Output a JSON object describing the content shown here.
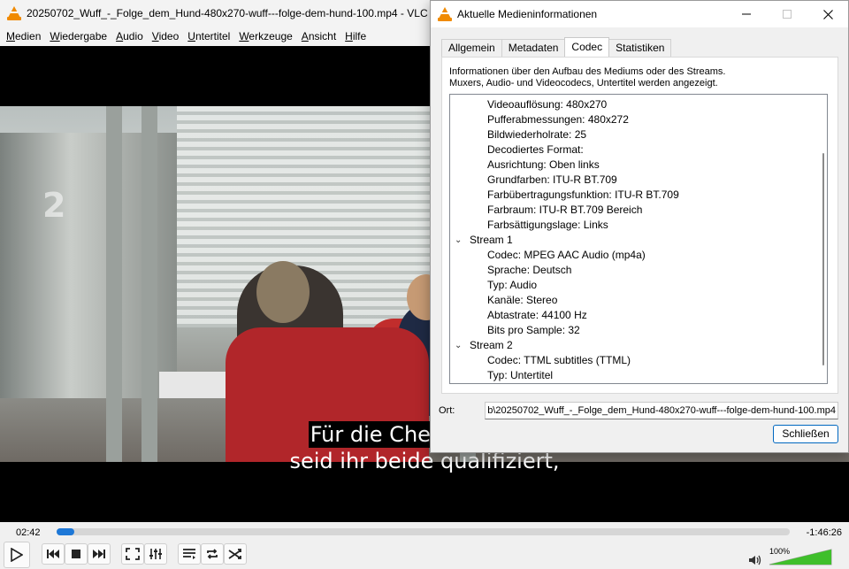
{
  "vlc": {
    "title": "20250702_Wuff_-_Folge_dem_Hund-480x270-wuff---folge-dem-hund-100.mp4 - VLC",
    "menu": [
      "Medien",
      "Wiedergabe",
      "Audio",
      "Video",
      "Untertitel",
      "Werkzeuge",
      "Ansicht",
      "Hilfe"
    ],
    "video": {
      "channel_logo": "2",
      "subtitle_line1": "Für die Chefredaktion",
      "subtitle_line2": "seid ihr beide qualifiziert,"
    },
    "controls": {
      "time_current": "02:42",
      "time_remaining": "-1:46:26",
      "progress_percent": 2.4,
      "volume_label": "100%",
      "volume_percent": 100
    }
  },
  "dialog": {
    "title": "Aktuelle Medieninformationen",
    "tabs": [
      "Allgemein",
      "Metadaten",
      "Codec",
      "Statistiken"
    ],
    "active_tab": "Codec",
    "description_line1": "Informationen über den Aufbau des Mediums oder des Streams.",
    "description_line2": "Muxers, Audio- und Videocodecs, Untertitel werden angezeigt.",
    "tree": [
      {
        "type": "child",
        "text": "Videoauflösung: 480x270"
      },
      {
        "type": "child",
        "text": "Pufferabmessungen: 480x272"
      },
      {
        "type": "child",
        "text": "Bildwiederholrate: 25"
      },
      {
        "type": "child",
        "text": "Decodiertes Format:"
      },
      {
        "type": "child",
        "text": "Ausrichtung: Oben links"
      },
      {
        "type": "child",
        "text": "Grundfarben: ITU-R BT.709"
      },
      {
        "type": "child",
        "text": "Farbübertragungsfunktion: ITU-R BT.709"
      },
      {
        "type": "child",
        "text": "Farbraum: ITU-R BT.709 Bereich"
      },
      {
        "type": "child",
        "text": "Farbsättigungslage: Links"
      },
      {
        "type": "stream",
        "text": "Stream 1"
      },
      {
        "type": "child",
        "text": "Codec: MPEG AAC Audio (mp4a)"
      },
      {
        "type": "child",
        "text": "Sprache: Deutsch"
      },
      {
        "type": "child",
        "text": "Typ: Audio"
      },
      {
        "type": "child",
        "text": "Kanäle: Stereo"
      },
      {
        "type": "child",
        "text": "Abtastrate: 44100 Hz"
      },
      {
        "type": "child",
        "text": "Bits pro Sample: 32"
      },
      {
        "type": "stream",
        "text": "Stream 2"
      },
      {
        "type": "child",
        "text": "Codec: TTML subtitles (TTML)"
      },
      {
        "type": "child",
        "text": "Typ: Untertitel"
      }
    ],
    "ort_label": "Ort:",
    "ort_value": "b\\20250702_Wuff_-_Folge_dem_Hund-480x270-wuff---folge-dem-hund-100.mp4",
    "close_label": "Schließen"
  }
}
